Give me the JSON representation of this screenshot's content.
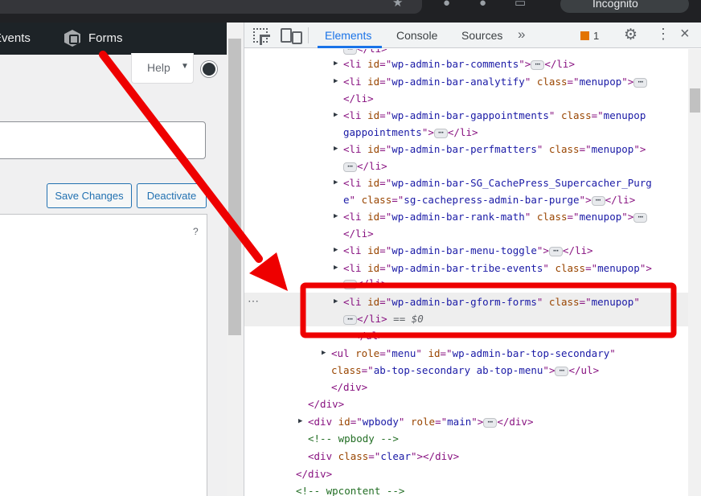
{
  "browser": {
    "incognito_label": "Incognito"
  },
  "wp": {
    "adminbar": {
      "events_label": "Events",
      "forms_label": "Forms"
    },
    "help_label": "Help",
    "save_label": "Save Changes",
    "deactivate_label": "Deactivate",
    "panel_help": "?"
  },
  "devtools": {
    "tabs": {
      "elements": "Elements",
      "console": "Console",
      "sources": "Sources",
      "more": "»"
    },
    "issues_count": "1",
    "selected_marker": "== $0"
  },
  "colors": {
    "annotation_red": "#ee0000",
    "selection_bg": "#eeeeee",
    "accent_blue": "#1a73e8"
  }
}
